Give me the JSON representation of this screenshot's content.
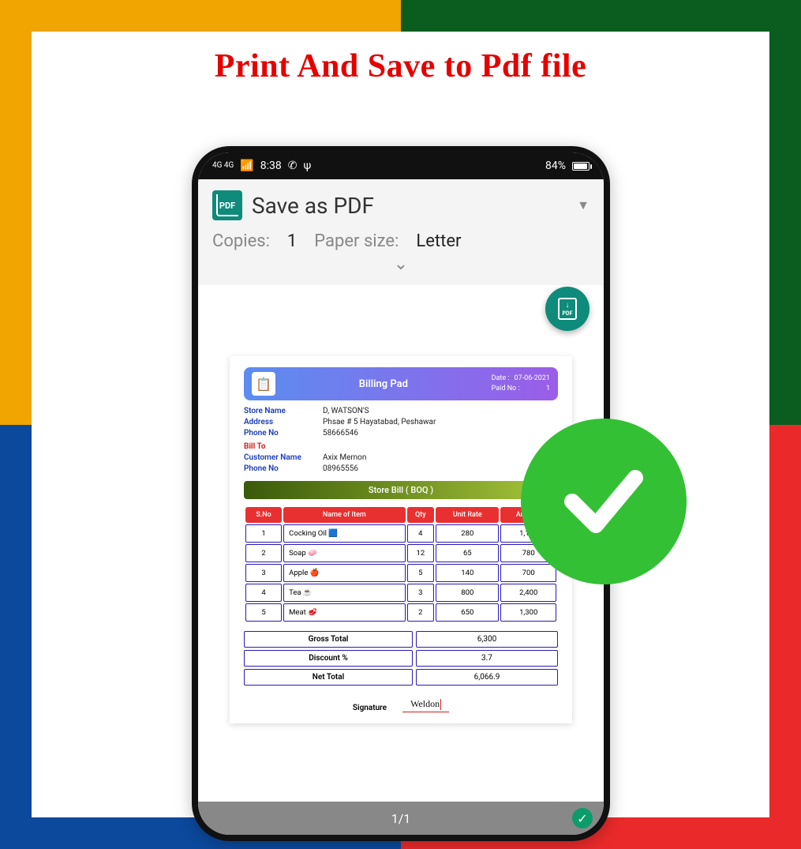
{
  "headline": "Print And Save to Pdf file",
  "status_bar": {
    "signal": "4G 4G",
    "time": "8:38",
    "battery_pct": "84%"
  },
  "print_dialog": {
    "target_label": "Save as PDF",
    "copies_label": "Copies:",
    "copies_value": "1",
    "paper_label": "Paper size:",
    "paper_value": "Letter"
  },
  "fab": {
    "label": "Download PDF"
  },
  "bill": {
    "title": "Billing Pad",
    "date_label": "Date :",
    "date_value": "07-06-2021",
    "paid_label": "Paid No :",
    "paid_value": "1",
    "store_name_label": "Store Name",
    "store_name_value": "D, WATSON'S",
    "address_label": "Address",
    "address_value": "Phsae # 5 Hayatabad, Peshawar",
    "phone_label": "Phone No",
    "phone_value": "58666546",
    "bill_to_label": "Bill To",
    "customer_name_label": "Customer Name",
    "customer_name_value": "Axix Memon",
    "customer_phone_label": "Phone No",
    "customer_phone_value": "08965556",
    "section_banner": "Store Bill ( BOQ )",
    "columns": {
      "sno": "S.No",
      "item": "Name of Item",
      "qty": "Qty",
      "rate": "Unit Rate",
      "amount": "Amount"
    },
    "rows": [
      {
        "sno": "1",
        "item": "Cocking Oil 🟦",
        "qty": "4",
        "rate": "280",
        "amount": "1,120"
      },
      {
        "sno": "2",
        "item": "Soap 🧼",
        "qty": "12",
        "rate": "65",
        "amount": "780"
      },
      {
        "sno": "3",
        "item": "Apple 🍎",
        "qty": "5",
        "rate": "140",
        "amount": "700"
      },
      {
        "sno": "4",
        "item": "Tea ☕",
        "qty": "3",
        "rate": "800",
        "amount": "2,400"
      },
      {
        "sno": "5",
        "item": "Meat 🥩",
        "qty": "2",
        "rate": "650",
        "amount": "1,300"
      }
    ],
    "gross_label": "Gross Total",
    "gross_value": "6,300",
    "discount_label": "Discount %",
    "discount_value": "3.7",
    "net_label": "Net Total",
    "net_value": "6,066.9",
    "signature_label": "Signature",
    "signature_value": "Weldon"
  },
  "pager": {
    "page": "1/1"
  }
}
